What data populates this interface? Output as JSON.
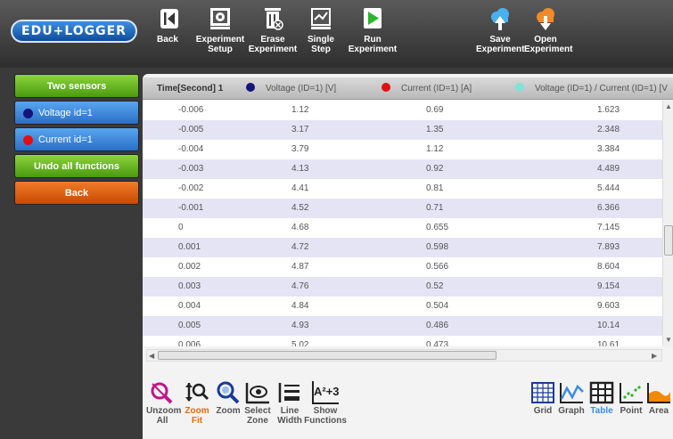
{
  "app": {
    "logo": "EDU+LOGGER"
  },
  "toolbar": {
    "back": "Back",
    "experiment_setup": "Experiment\nSetup",
    "erase_experiment": "Erase\nExperiment",
    "single_step": "Single\nStep",
    "run_experiment": "Run\nExperiment",
    "save_experiment": "Save\nExperiment",
    "open_experiment": "Open\nExperiment"
  },
  "sidebar": {
    "two_sensors": "Two sensors",
    "voltage": "Voltage id=1",
    "current": "Current id=1",
    "undo_all": "Undo all functions",
    "back": "Back"
  },
  "colors": {
    "voltage": "#1a1a8c",
    "current": "#e01010",
    "ratio": "#7fe3d8"
  },
  "table": {
    "headers": [
      "Time[Second] 1",
      "Voltage (ID=1) [V]",
      "Current (ID=1) [A]",
      "Voltage (ID=1) / Current (ID=1) [V"
    ],
    "rows": [
      [
        "-0.006",
        "1.12",
        "0.69",
        "1.623"
      ],
      [
        "-0.005",
        "3.17",
        "1.35",
        "2.348"
      ],
      [
        "-0.004",
        "3.79",
        "1.12",
        "3.384"
      ],
      [
        "-0.003",
        "4.13",
        "0.92",
        "4.489"
      ],
      [
        "-0.002",
        "4.41",
        "0.81",
        "5.444"
      ],
      [
        "-0.001",
        "4.52",
        "0.71",
        "6.366"
      ],
      [
        "0",
        "4.68",
        "0.655",
        "7.145"
      ],
      [
        "0.001",
        "4.72",
        "0.598",
        "7.893"
      ],
      [
        "0.002",
        "4.87",
        "0.566",
        "8.604"
      ],
      [
        "0.003",
        "4.76",
        "0.52",
        "9.154"
      ],
      [
        "0.004",
        "4.84",
        "0.504",
        "9.603"
      ],
      [
        "0.005",
        "4.93",
        "0.486",
        "10.14"
      ],
      [
        "0.006",
        "5.02",
        "0.473",
        "10.61"
      ]
    ]
  },
  "bottom_tools": {
    "unzoom_all": "Unzoom\nAll",
    "zoom_fit": "Zoom\nFit",
    "zoom": "Zoom",
    "select_zone": "Select\nZone",
    "line_width": "Line\nWidth",
    "show_functions": "Show\nFunctions",
    "show_functions_icon": "A²+3",
    "grid": "Grid",
    "graph": "Graph",
    "table": "Table",
    "point": "Point",
    "area": "Area"
  }
}
